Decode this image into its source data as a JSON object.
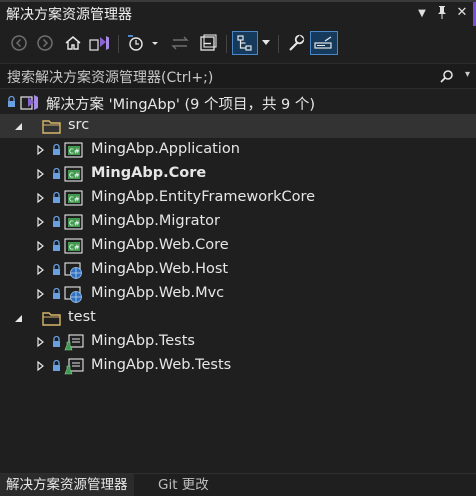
{
  "window": {
    "title": "解决方案资源管理器",
    "controls": {
      "dropdown": "▼",
      "pin": "⊥",
      "close": "✕"
    }
  },
  "toolbar": {
    "buttons": [
      "back-icon",
      "forward-icon",
      "home-icon",
      "vs-switch-icon",
      "pending-changes-icon",
      "sync-icon",
      "collapse-all-icon",
      "show-all-files-icon",
      "properties-icon",
      "preview-icon"
    ]
  },
  "search": {
    "placeholder": "搜索解决方案资源管理器(Ctrl+;)",
    "dropdown": "▾"
  },
  "tree": {
    "solution": "解决方案 'MingAbp' (9 个项目，共 9 个)",
    "folders": [
      {
        "label": "src"
      },
      {
        "label": "test"
      }
    ],
    "projects": [
      {
        "label": "MingAbp.Application",
        "kind": "csharp"
      },
      {
        "label": "MingAbp.Core",
        "kind": "csharp",
        "bold": true
      },
      {
        "label": "MingAbp.EntityFrameworkCore",
        "kind": "csharp"
      },
      {
        "label": "MingAbp.Migrator",
        "kind": "csharp"
      },
      {
        "label": "MingAbp.Web.Core",
        "kind": "csharp"
      },
      {
        "label": "MingAbp.Web.Host",
        "kind": "web"
      },
      {
        "label": "MingAbp.Web.Mvc",
        "kind": "web"
      },
      {
        "label": "MingAbp.Tests",
        "kind": "test"
      },
      {
        "label": "MingAbp.Web.Tests",
        "kind": "test"
      }
    ]
  },
  "tabs": [
    {
      "label": "解决方案资源管理器",
      "active": true
    },
    {
      "label": "Git 更改",
      "active": false
    }
  ],
  "colors": {
    "background": "#1f1f1f",
    "selection": "#333333",
    "accent": "#4a86c8",
    "csharp_icon": "#3f9a4f",
    "folder": "#d8b66a",
    "vs_purple": "#8a63d2"
  }
}
